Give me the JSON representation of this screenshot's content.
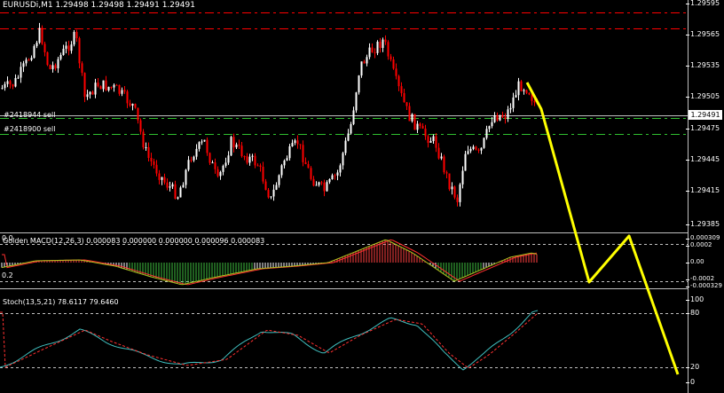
{
  "main": {
    "header": "EURUSDi,M1  1.29498 1.29498 1.29491 1.29491",
    "price_axis": [
      "1.29595",
      "1.29565",
      "1.29535",
      "1.29505",
      "1.29475",
      "1.29445",
      "1.29415",
      "1.29385"
    ],
    "current_price": "1.29491",
    "orders": [
      "#2418944 sell",
      "#2418900 sell"
    ],
    "colors": {
      "bull": "#ffffff",
      "bear": "#ff0000",
      "grid_red": "#ff0000",
      "grid_green": "#2fbf2f",
      "bid_line": "#c0c0c0"
    }
  },
  "macd": {
    "header": "Golden MACD(12,26,3) 0.000083 0.000000 0.000000 0.000096 0.000083",
    "axis": [
      "0.000309",
      "0.0002",
      "0.00",
      "-0.0002",
      "-0.000329"
    ],
    "zero_label": "0.00",
    "left_marker_top": "0.0",
    "left_marker_bottom": "0.2"
  },
  "stoch": {
    "header": "Stoch(13,5,21) 78.6117 79.6460",
    "axis": [
      "100",
      "80",
      "20",
      "0"
    ]
  },
  "annotation": {
    "color": "#ffff00",
    "type": "forecast-zigzag"
  }
}
